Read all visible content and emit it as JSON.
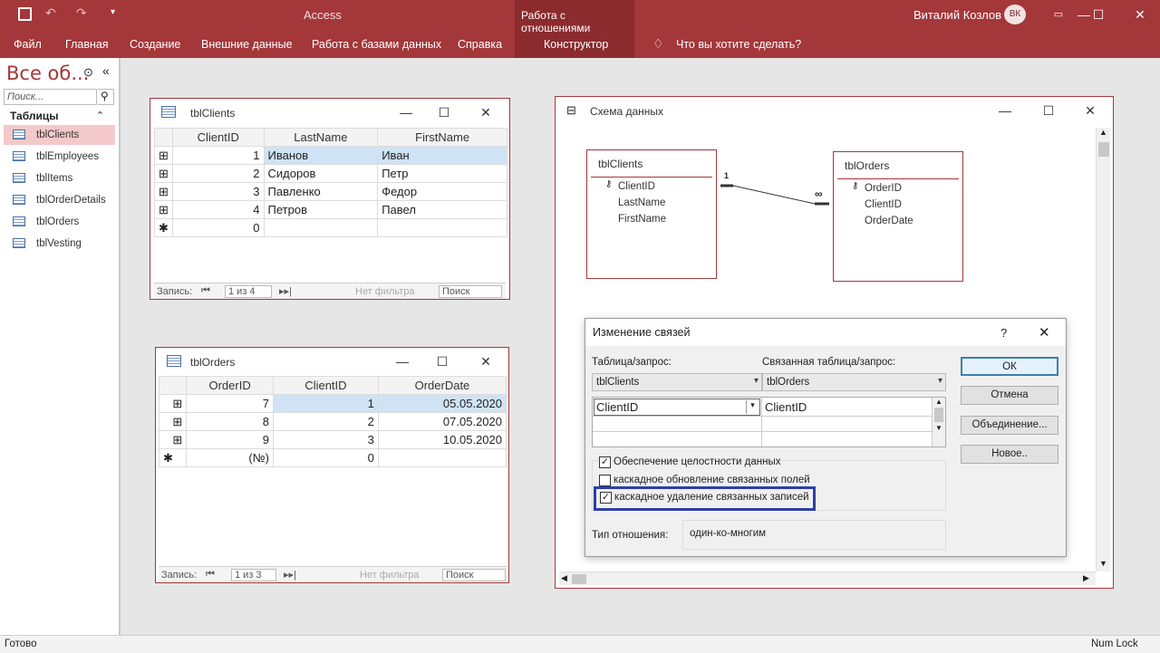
{
  "titlebar": {
    "app": "Access",
    "context_tab": "Работа с отношениями",
    "user": "Виталий Козлов",
    "initials": "ВК"
  },
  "ribbon": {
    "tabs": [
      "Файл",
      "Главная",
      "Создание",
      "Внешние данные",
      "Работа с базами данных",
      "Справка",
      "Конструктор"
    ],
    "tell_me": "Что вы хотите сделать?"
  },
  "nav": {
    "title": "Все об...",
    "search_placeholder": "Поиск...",
    "section": "Таблицы",
    "items": [
      "tblClients",
      "tblEmployees",
      "tblItems",
      "tblOrderDetails",
      "tblOrders",
      "tblVesting"
    ]
  },
  "tblClients": {
    "title": "tblClients",
    "columns": [
      "ClientID",
      "LastName",
      "FirstName"
    ],
    "rows": [
      [
        "1",
        "Иванов",
        "Иван"
      ],
      [
        "2",
        "Сидоров",
        "Петр"
      ],
      [
        "3",
        "Павленко",
        "Федор"
      ],
      [
        "4",
        "Петров",
        "Павел"
      ]
    ],
    "newrow": "0",
    "status": {
      "label": "Запись:",
      "pos": "1 из 4",
      "filter": "Нет фильтра",
      "search": "Поиск"
    }
  },
  "tblOrders": {
    "title": "tblOrders",
    "columns": [
      "OrderID",
      "ClientID",
      "OrderDate"
    ],
    "rows": [
      [
        "7",
        "1",
        "05.05.2020"
      ],
      [
        "8",
        "2",
        "07.05.2020"
      ],
      [
        "9",
        "3",
        "10.05.2020"
      ]
    ],
    "newrow": [
      "(№)",
      "0"
    ],
    "status": {
      "label": "Запись:",
      "pos": "1 из 3",
      "filter": "Нет фильтра",
      "search": "Поиск"
    }
  },
  "schema": {
    "title": "Схема данных",
    "entities": [
      {
        "name": "tblClients",
        "fields": [
          "ClientID",
          "LastName",
          "FirstName"
        ]
      },
      {
        "name": "tblOrders",
        "fields": [
          "OrderID",
          "ClientID",
          "OrderDate"
        ]
      }
    ],
    "rel_one": "1",
    "rel_many": "∞"
  },
  "dialog": {
    "title": "Изменение связей",
    "help": "?",
    "table_label": "Таблица/запрос:",
    "related_label": "Связанная таблица/запрос:",
    "table": "tblClients",
    "related": "tblOrders",
    "field_left": "ClientID",
    "field_right": "ClientID",
    "integrity": "Обеспечение целостности данных",
    "cascade_update": "каскадное обновление связанных полей",
    "cascade_delete": "каскадное удаление связанных записей",
    "type_label": "Тип отношения:",
    "type_value": "один-ко-многим",
    "buttons": {
      "ok": "ОК",
      "cancel": "Отмена",
      "join": "Объединение...",
      "new": "Новое.."
    },
    "checks": {
      "integrity": true,
      "cascade_update": false,
      "cascade_delete": true
    }
  },
  "statusbar": {
    "left": "Готово",
    "right": "Num Lock"
  },
  "colors": {
    "accent": "#a4373a",
    "highlight_border": "#2d3fa8"
  }
}
